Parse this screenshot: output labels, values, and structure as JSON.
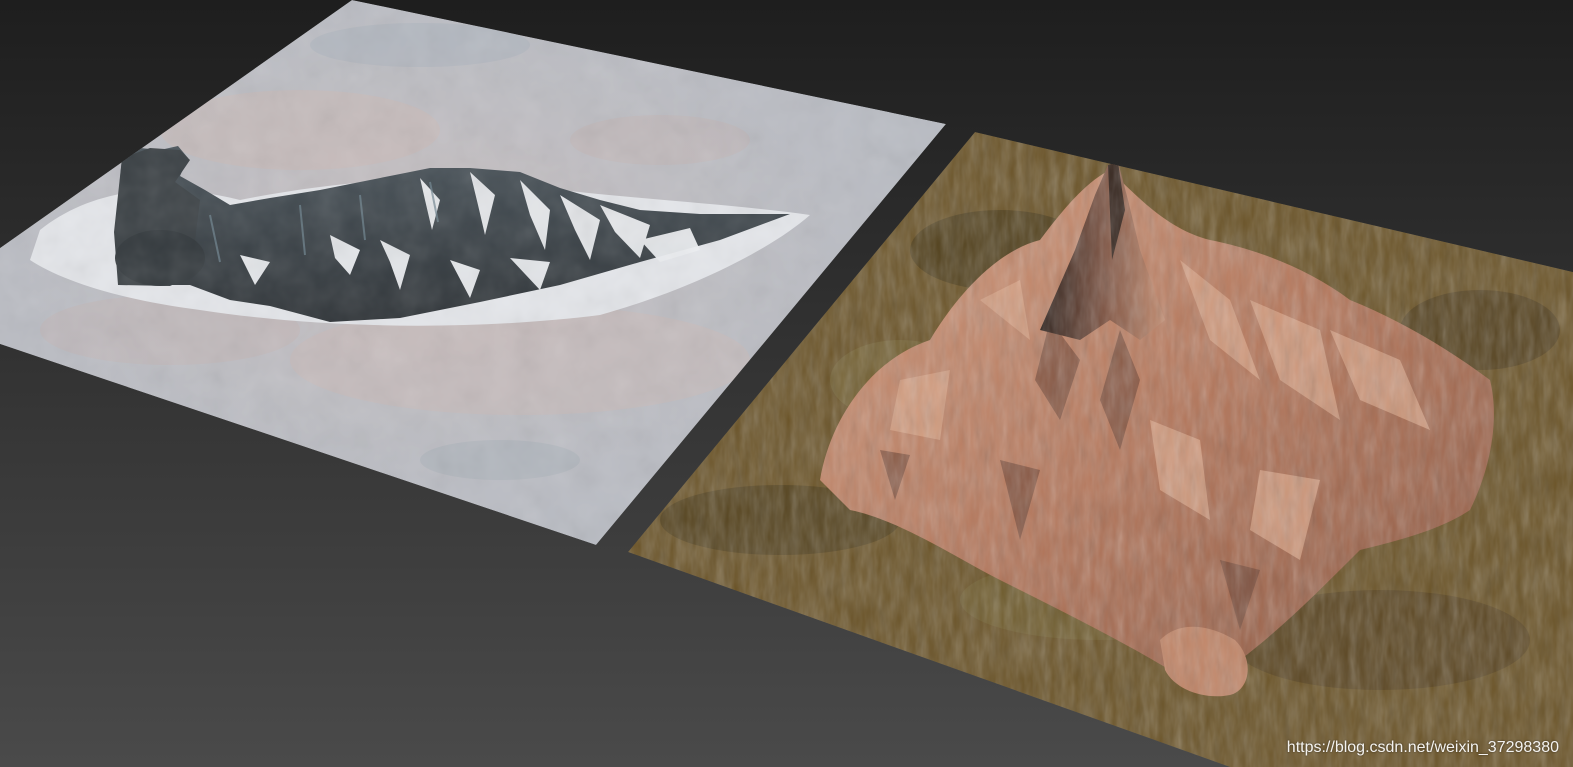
{
  "viewport": {
    "background_top": "#1e1e1e",
    "background_bottom": "#4a4a4a",
    "watermark": "https://blog.csdn.net/weixin_37298380"
  },
  "terrains": {
    "snow": {
      "description_colors": {
        "plane": "#b9bcc3",
        "rock": "#3b4146",
        "rock_highlight": "#5f6f78",
        "snow": "#e6e8ec",
        "tint": "#c8b2ad"
      }
    },
    "desert": {
      "description_colors": {
        "plane": "#6b5428",
        "plane_dark": "#4e3d1d",
        "rock": "#b77a5c",
        "rock_light": "#d19a7e",
        "rock_dark": "#5e3b2c",
        "moss": "#7a6a3a"
      }
    }
  }
}
